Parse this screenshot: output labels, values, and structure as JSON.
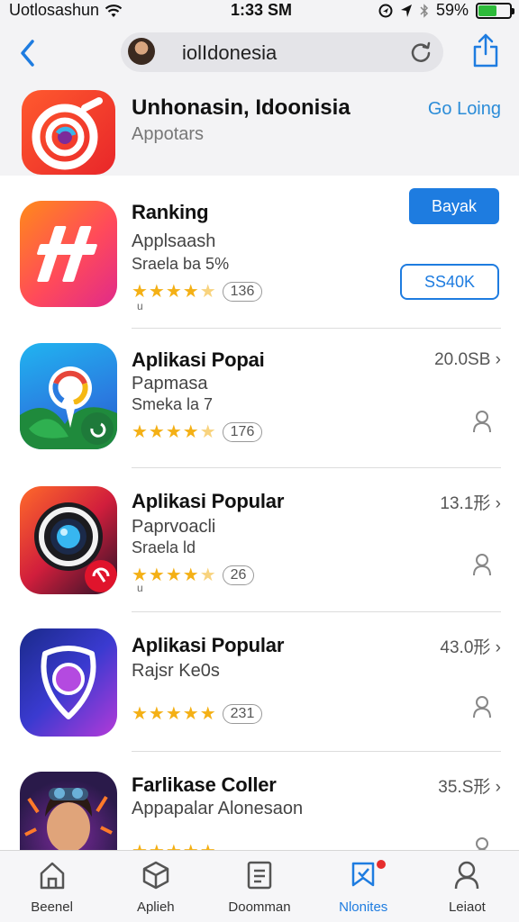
{
  "status": {
    "carrier": "Uotlosashun",
    "time": "1:33 SM",
    "battery_pct": "59%",
    "battery_level": 0.59,
    "icons": [
      "wifi-icon",
      "location-icon",
      "bluetooth-icon",
      "battery-icon"
    ]
  },
  "nav": {
    "url": "iolIdonesia",
    "back_icon": "chevron-left-icon",
    "reload_icon": "reload-icon",
    "share_icon": "share-icon"
  },
  "hero": {
    "title": "Unhonasin, Idoonisia",
    "subtitle": "Appotars",
    "link": "Go Loing"
  },
  "apps": [
    {
      "name": "Ranking",
      "sub1": "Applsaash",
      "sub2": "Sraela ba 5%",
      "rating": 4.5,
      "count": "136",
      "button_primary": "Bayak",
      "button_outline": "SS40K",
      "tiny": "u"
    },
    {
      "name": "Aplikasi Popai",
      "sub1": "Papmasa",
      "sub2": "Smeka la 7",
      "rating": 4.5,
      "count": "176",
      "size": "20.0SB",
      "tiny": ""
    },
    {
      "name": "Aplikasi Popular",
      "sub1": "Paprvoacli",
      "sub2": "Sraela ld",
      "rating": 4.5,
      "count": "26",
      "size": "13.1形",
      "tiny": "u"
    },
    {
      "name": "Aplikasi Popular",
      "sub1": "Rajsr Ke0s",
      "sub2": "",
      "rating": 5,
      "count": "231",
      "size": "43.0形"
    },
    {
      "name": "Farlikase Coller",
      "sub1": "Appapalar Alonesaon",
      "sub2": "",
      "rating": 5,
      "count": "",
      "size": "35.S形"
    }
  ],
  "tabs": [
    {
      "label": "Beenel",
      "icon": "home-icon"
    },
    {
      "label": "Aplieh",
      "icon": "cube-icon"
    },
    {
      "label": "Doomman",
      "icon": "document-icon"
    },
    {
      "label": "Nlonites",
      "icon": "bookmark-icon",
      "active": true
    },
    {
      "label": "Leiaot",
      "icon": "person-icon"
    }
  ],
  "colors": {
    "accent": "#1e7ce0",
    "star": "#f4b015",
    "badge": "#e62d2d"
  }
}
